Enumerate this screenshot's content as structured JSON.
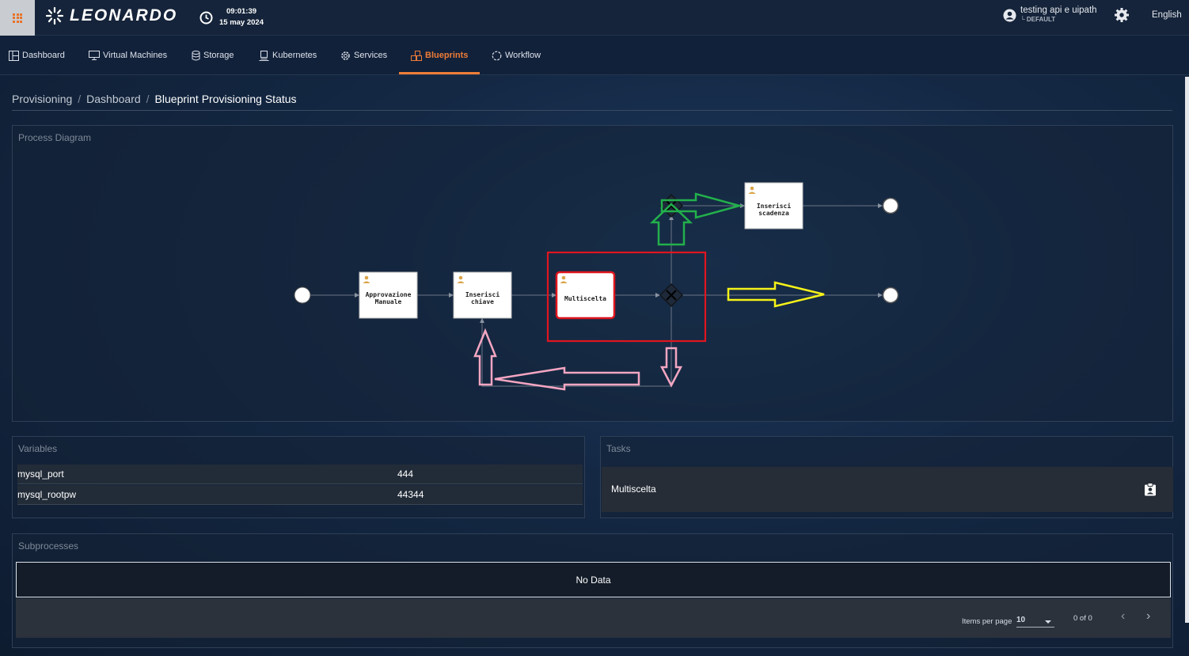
{
  "header": {
    "brand": "LEONARDO",
    "time": "09:01:39",
    "date": "15 may 2024",
    "user_name": "testing api e uipath",
    "user_tenant": "└ DEFAULT",
    "language": "English"
  },
  "nav": {
    "items": [
      {
        "label": "Dashboard",
        "icon": "dashboard-icon"
      },
      {
        "label": "Virtual Machines",
        "icon": "monitor-icon"
      },
      {
        "label": "Storage",
        "icon": "database-icon"
      },
      {
        "label": "Kubernetes",
        "icon": "kubernetes-icon"
      },
      {
        "label": "Services",
        "icon": "gear-icon"
      },
      {
        "label": "Blueprints",
        "icon": "blueprint-icon",
        "active": true
      },
      {
        "label": "Workflow",
        "icon": "refresh-icon"
      }
    ],
    "accent": "#ee7d37"
  },
  "breadcrumb": {
    "items": [
      "Provisioning",
      "Dashboard"
    ],
    "current": "Blueprint Provisioning Status"
  },
  "diagram": {
    "title": "Process Diagram",
    "tasks": [
      {
        "line1": "Approvazione",
        "line2": "Manuale"
      },
      {
        "line1": "Inserisci",
        "line2": "chiave"
      },
      {
        "line1": "Multiscelta",
        "line2": "",
        "active": true
      },
      {
        "line1": "Inserisci",
        "line2": "scadenza"
      }
    ],
    "annotation_colors": {
      "highlight_box": "#e0151f",
      "green_arrow": "#22b04b",
      "yellow_arrow": "#f5f218",
      "pink_arrow": "#f4a6c2"
    }
  },
  "variables": {
    "title": "Variables",
    "rows": [
      {
        "key": "mysql_port",
        "value": "444"
      },
      {
        "key": "mysql_rootpw",
        "value": "44344"
      }
    ]
  },
  "tasks": {
    "title": "Tasks",
    "rows": [
      {
        "name": "Multiscelta",
        "icon": "clipboard-user-icon"
      }
    ]
  },
  "subprocesses": {
    "title": "Subprocesses",
    "empty_text": "No Data",
    "items_per_page_label": "Items per page",
    "items_per_page": "10",
    "range_label": "0 of 0"
  }
}
